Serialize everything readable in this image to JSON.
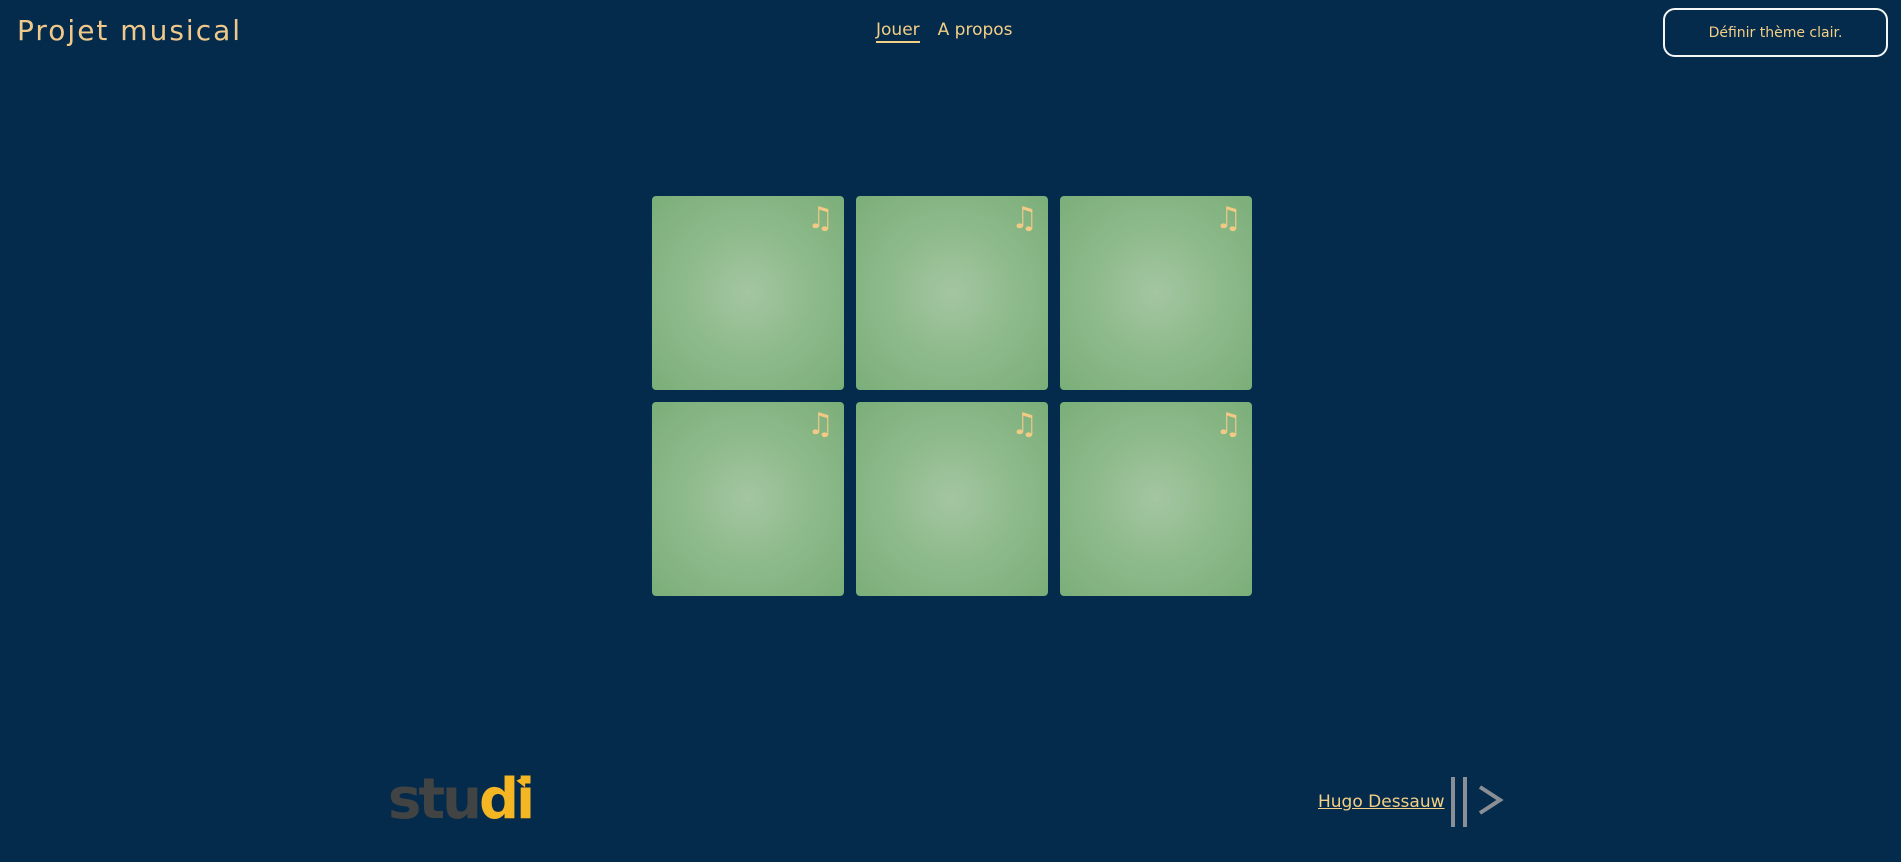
{
  "header": {
    "site_title": "Projet musical",
    "nav": [
      {
        "label": "Jouer",
        "active": true
      },
      {
        "label": "A propos",
        "active": false
      }
    ],
    "theme_button_label": "Définir thème clair."
  },
  "board": {
    "tiles": [
      {
        "icon": "music-note-icon"
      },
      {
        "icon": "music-note-icon"
      },
      {
        "icon": "music-note-icon"
      },
      {
        "icon": "music-note-icon"
      },
      {
        "icon": "music-note-icon"
      },
      {
        "icon": "music-note-icon"
      }
    ],
    "note_glyph": "♫"
  },
  "footer": {
    "logo": {
      "text_stu": "stu",
      "text_di": "di"
    },
    "author_link": "Hugo Dessauw",
    "author_mark_icon": "chevron-right-logo-icon"
  },
  "colors": {
    "background": "#042b4c",
    "accent": "#f4cf86",
    "tile": "#8fbb8c",
    "studi_gray": "#424343",
    "studi_yellow": "#f5b623"
  }
}
